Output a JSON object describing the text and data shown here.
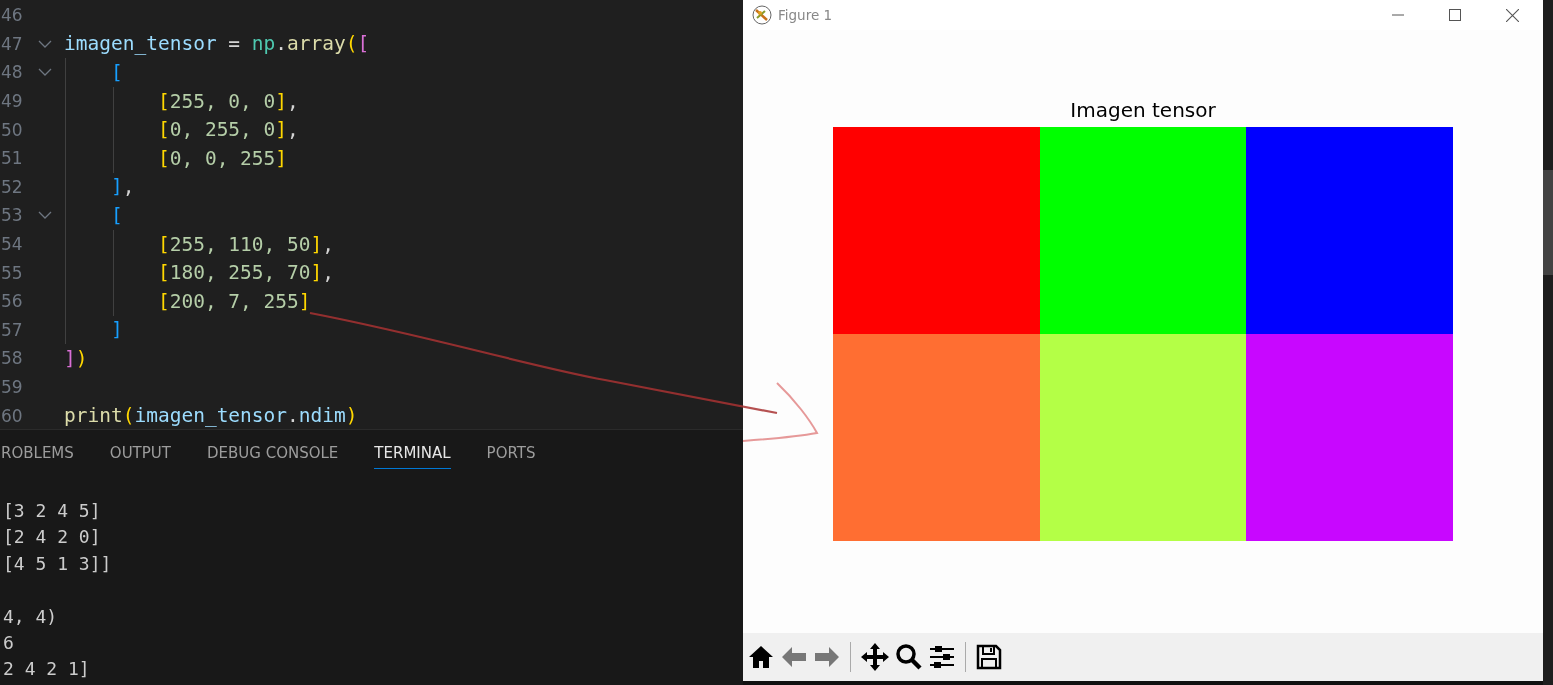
{
  "editor": {
    "lines": [
      {
        "number": "46",
        "fold": false
      },
      {
        "number": "47",
        "fold": true,
        "tokens": [
          {
            "text": "imagen_tensor",
            "kind": "variable"
          },
          {
            "text": " = ",
            "kind": "operator"
          },
          {
            "text": "np",
            "kind": "module"
          },
          {
            "text": ".",
            "kind": "operator"
          },
          {
            "text": "array",
            "kind": "function"
          },
          {
            "text": "(",
            "kind": "bracket1"
          },
          {
            "text": "[",
            "kind": "bracket2"
          }
        ]
      },
      {
        "number": "48",
        "fold": true,
        "tokens": [
          {
            "text": "    [",
            "kind": "bracket3"
          }
        ]
      },
      {
        "number": "49",
        "fold": false,
        "tokens": [
          {
            "text": "        [",
            "kind": "bracket1"
          },
          {
            "text": "255, 0, 0",
            "kind": "number"
          },
          {
            "text": "]",
            "kind": "bracket1"
          },
          {
            "text": ",",
            "kind": "operator"
          }
        ]
      },
      {
        "number": "50",
        "fold": false,
        "tokens": [
          {
            "text": "        [",
            "kind": "bracket1"
          },
          {
            "text": "0, 255, 0",
            "kind": "number"
          },
          {
            "text": "]",
            "kind": "bracket1"
          },
          {
            "text": ",",
            "kind": "operator"
          }
        ]
      },
      {
        "number": "51",
        "fold": false,
        "tokens": [
          {
            "text": "        [",
            "kind": "bracket1"
          },
          {
            "text": "0, 0, 255",
            "kind": "number"
          },
          {
            "text": "]",
            "kind": "bracket1"
          }
        ]
      },
      {
        "number": "52",
        "fold": false,
        "tokens": [
          {
            "text": "    ]",
            "kind": "bracket3"
          },
          {
            "text": ",",
            "kind": "operator"
          }
        ]
      },
      {
        "number": "53",
        "fold": true,
        "tokens": [
          {
            "text": "    [",
            "kind": "bracket3"
          }
        ]
      },
      {
        "number": "54",
        "fold": false,
        "tokens": [
          {
            "text": "        [",
            "kind": "bracket1"
          },
          {
            "text": "255, 110, 50",
            "kind": "number"
          },
          {
            "text": "]",
            "kind": "bracket1"
          },
          {
            "text": ",",
            "kind": "operator"
          }
        ]
      },
      {
        "number": "55",
        "fold": false,
        "tokens": [
          {
            "text": "        [",
            "kind": "bracket1"
          },
          {
            "text": "180, 255, 70",
            "kind": "number"
          },
          {
            "text": "]",
            "kind": "bracket1"
          },
          {
            "text": ",",
            "kind": "operator"
          }
        ]
      },
      {
        "number": "56",
        "fold": false,
        "tokens": [
          {
            "text": "        [",
            "kind": "bracket1"
          },
          {
            "text": "200, 7, 255",
            "kind": "number"
          },
          {
            "text": "]",
            "kind": "bracket1"
          }
        ]
      },
      {
        "number": "57",
        "fold": false,
        "tokens": [
          {
            "text": "    ]",
            "kind": "bracket3"
          }
        ]
      },
      {
        "number": "58",
        "fold": false,
        "tokens": [
          {
            "text": "]",
            "kind": "bracket2"
          },
          {
            "text": ")",
            "kind": "bracket1"
          }
        ]
      },
      {
        "number": "59",
        "fold": false
      },
      {
        "number": "60",
        "fold": false,
        "tokens": [
          {
            "text": "print",
            "kind": "function"
          },
          {
            "text": "(",
            "kind": "bracket1"
          },
          {
            "text": "imagen_tensor",
            "kind": "variable"
          },
          {
            "text": ".",
            "kind": "operator"
          },
          {
            "text": "ndim",
            "kind": "variable"
          },
          {
            "text": ")",
            "kind": "bracket1"
          }
        ]
      }
    ]
  },
  "panel": {
    "tabs": [
      {
        "label": "ROBLEMS",
        "selected": false
      },
      {
        "label": "OUTPUT",
        "selected": false
      },
      {
        "label": "DEBUG CONSOLE",
        "selected": false
      },
      {
        "label": "TERMINAL",
        "selected": true
      },
      {
        "label": "PORTS",
        "selected": false
      }
    ],
    "terminal_lines": [
      "[3 2 4 5]",
      "[2 4 2 0]",
      "[4 5 1 3]]",
      "4, 4)",
      "6",
      "2 4 2 1]"
    ]
  },
  "figure": {
    "title": "Figure 1",
    "plot_title": "Imagen tensor",
    "image_rows": [
      [
        {
          "color": "#ff0000"
        },
        {
          "color": "#00ff00"
        },
        {
          "color": "#0000ff"
        }
      ],
      [
        {
          "color": "#ff6e32"
        },
        {
          "color": "#b4ff46"
        },
        {
          "color": "#c807ff"
        }
      ]
    ]
  }
}
